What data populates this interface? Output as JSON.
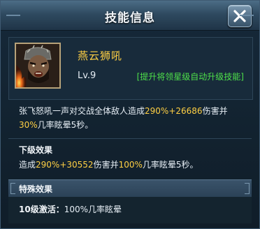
{
  "window": {
    "title": "技能信息",
    "close_icon": "close-x-icon"
  },
  "skill": {
    "name": "燕云狮吼",
    "level": "Lv.9",
    "upgrade_hint": "[提升将领星级自动升级技能]",
    "portrait": "warrior-portrait-icon",
    "description": {
      "part1": "张飞怒吼一声对交战全体敌人造成",
      "pct": "290%+26686",
      "part2": "伤害并",
      "chance": "30%",
      "part3": "几率眩晕5秒。"
    }
  },
  "next_level": {
    "title": "下级效果",
    "part1": "造成",
    "pct": "290%+30552",
    "part2": "伤害并",
    "chance": "100%",
    "part3": "几率眩晕5秒。"
  },
  "special": {
    "title": "特殊效果",
    "label": "10级激活：",
    "value": "100%几率眩晕"
  },
  "colors": {
    "highlight": "#ffd044",
    "hint_green": "#4ee04a",
    "panel_bg": "#12222f"
  }
}
